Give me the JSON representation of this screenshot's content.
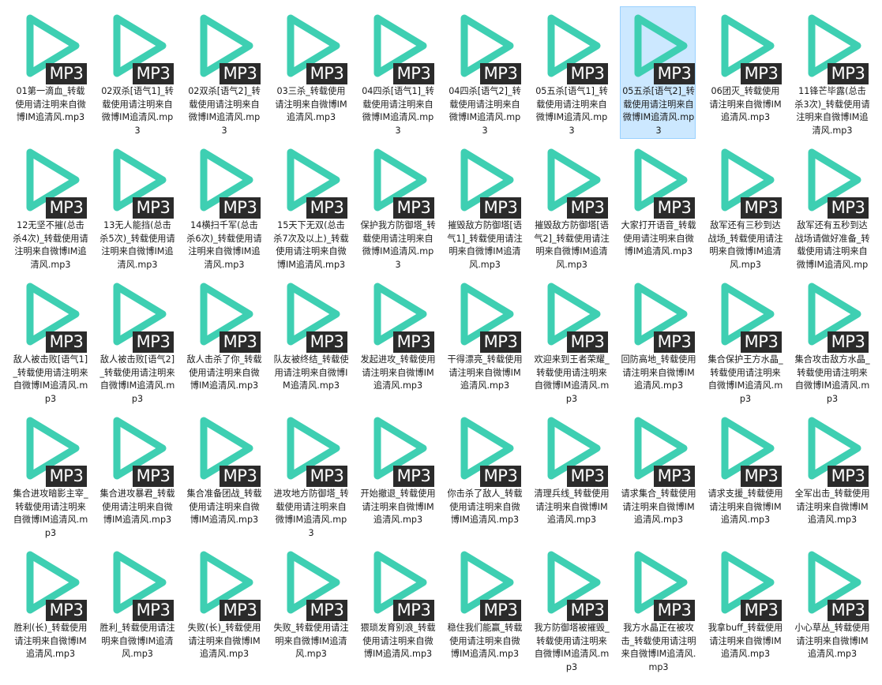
{
  "colors": {
    "play_icon": "#3ecfb2",
    "badge_bg": "#2b2b2b",
    "badge_text": "#ffffff",
    "selection_bg": "#cce8ff",
    "selection_border": "#99d1ff"
  },
  "icon": "play-triangle-icon",
  "badge_label": "MP3",
  "files": [
    {
      "name": "01第一滴血_转载使用请注明来自微博IM追清风.mp3"
    },
    {
      "name": "02双杀[语气1]_转载使用请注明来自微博IM追清风.mp3"
    },
    {
      "name": "02双杀[语气2]_转载使用请注明来自微博IM追清风.mp3"
    },
    {
      "name": "03三杀_转载使用请注明来自微博IM追清风.mp3"
    },
    {
      "name": "04四杀[语气1]_转载使用请注明来自微博IM追清风.mp3"
    },
    {
      "name": "04四杀[语气2]_转载使用请注明来自微博IM追清风.mp3"
    },
    {
      "name": "05五杀[语气1]_转载使用请注明来自微博IM追清风.mp3"
    },
    {
      "name": "05五杀[语气2]_转载使用请注明来自微博IM追清风.mp3",
      "selected": true
    },
    {
      "name": "06团灭_转载使用请注明来自微博IM追清风.mp3"
    },
    {
      "name": "11锋芒毕露(总击杀3次)_转载使用请注明来自微博IM追清风.mp3"
    },
    {
      "name": "12无坚不摧(总击杀4次)_转载使用请注明来自微博IM追清风.mp3"
    },
    {
      "name": "13无人能挡(总击杀5次)_转载使用请注明来自微博IM追清风.mp3"
    },
    {
      "name": "14横扫千军(总击杀6次)_转载使用请注明来自微博IM追清风.mp3"
    },
    {
      "name": "15天下无双(总击杀7次及以上)_转载使用请注明来自微博IM追清风.mp3"
    },
    {
      "name": "保护我方防御塔_转载使用请注明来自微博IM追清风.mp3"
    },
    {
      "name": "摧毁敌方防御塔[语气1]_转载使用请注明来自微博IM追清风.mp3"
    },
    {
      "name": "摧毁敌方防御塔[语气2]_转载使用请注明来自微博IM追清风.mp3"
    },
    {
      "name": "大家打开语音_转载使用请注明来自微博IM追清风.mp3"
    },
    {
      "name": "敌军还有三秒到达战场_转载使用请注明来自微博IM追清风.mp3"
    },
    {
      "name": "敌军还有五秒到达战场请做好准备_转载使用请注明来自微博IM追清风.mp3"
    },
    {
      "name": "敌人被击败[语气1]_转载使用请注明来自微博IM追清风.mp3"
    },
    {
      "name": "敌人被击败[语气2]_转载使用请注明来自微博IM追清风.mp3"
    },
    {
      "name": "敌人击杀了你_转载使用请注明来自微博IM追清风.mp3"
    },
    {
      "name": "队友被终结_转载使用请注明来自微博IM追清风.mp3"
    },
    {
      "name": "发起进攻_转载使用请注明来自微博IM追清风.mp3"
    },
    {
      "name": "干得漂亮_转载使用请注明来自微博IM追清风.mp3"
    },
    {
      "name": "欢迎来到王者荣耀_转载使用请注明来自微博IM追清风.mp3"
    },
    {
      "name": "回防高地_转载使用请注明来自微博IM追清风.mp3"
    },
    {
      "name": "集合保护王方水晶_转载使用请注明来自微博IM追清风.mp3"
    },
    {
      "name": "集合攻击敌方水晶_转载使用请注明来自微博IM追清风.mp3"
    },
    {
      "name": "集合进攻暗影主宰_转载使用请注明来自微博IM追清风.mp3"
    },
    {
      "name": "集合进攻暴君_转载使用请注明来自微博IM追清风.mp3"
    },
    {
      "name": "集合准备团战_转载使用请注明来自微博IM追清风.mp3"
    },
    {
      "name": "进攻地方防御塔_转载使用请注明来自微博IM追清风.mp3"
    },
    {
      "name": "开始撤退_转载使用请注明来自微博IM追清风.mp3"
    },
    {
      "name": "你击杀了敌人_转载使用请注明来自微博IM追清风.mp3"
    },
    {
      "name": "清理兵线_转载使用请注明来自微博IM追清风.mp3"
    },
    {
      "name": "请求集合_转载使用请注明来自微博IM追清风.mp3"
    },
    {
      "name": "请求支援_转载使用请注明来自微博IM追清风.mp3"
    },
    {
      "name": "全军出击_转载使用请注明来自微博IM追清风.mp3"
    },
    {
      "name": "胜利(长)_转载使用请注明来自微博IM追清风.mp3"
    },
    {
      "name": "胜利_转载使用请注明来自微博IM追清风.mp3"
    },
    {
      "name": "失败(长)_转载使用请注明来自微博IM追清风.mp3"
    },
    {
      "name": "失败_转载使用请注明来自微博IM追清风.mp3"
    },
    {
      "name": "猥琐发育别浪_转载使用请注明来自微博IM追清风.mp3"
    },
    {
      "name": "稳住我们能赢_转载使用请注明来自微博IM追清风.mp3"
    },
    {
      "name": "我方防御塔被摧毁_转载使用请注明来自微博IM追清风.mp3"
    },
    {
      "name": "我方水晶正在被攻击_转载使用请注明来自微博IM追清风.mp3"
    },
    {
      "name": "我拿buff_转载使用请注明来自微博IM追清风.mp3"
    },
    {
      "name": "小心草丛_转载使用请注明来自微博IM追清风.mp3"
    }
  ]
}
